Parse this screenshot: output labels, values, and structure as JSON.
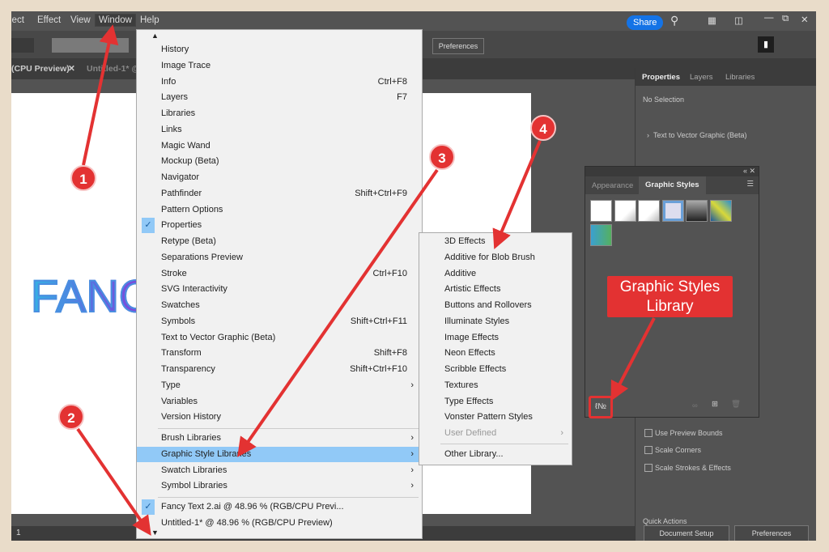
{
  "menubar": {
    "items": [
      "lect",
      "Effect",
      "View",
      "Window",
      "Help"
    ],
    "share": "Share"
  },
  "control": {
    "preferences": "Preferences"
  },
  "doc_tabs": [
    "(CPU Preview)",
    "Untitled-1* @"
  ],
  "artboard_text": "FANC",
  "status": {
    "zoom": "1"
  },
  "window_menu": {
    "items": [
      {
        "label": "History"
      },
      {
        "label": "Image Trace"
      },
      {
        "label": "Info",
        "shortcut": "Ctrl+F8"
      },
      {
        "label": "Layers",
        "shortcut": "F7"
      },
      {
        "label": "Libraries"
      },
      {
        "label": "Links"
      },
      {
        "label": "Magic Wand"
      },
      {
        "label": "Mockup (Beta)"
      },
      {
        "label": "Navigator"
      },
      {
        "label": "Pathfinder",
        "shortcut": "Shift+Ctrl+F9"
      },
      {
        "label": "Pattern Options"
      },
      {
        "label": "Properties",
        "checked": true
      },
      {
        "label": "Retype (Beta)"
      },
      {
        "label": "Separations Preview"
      },
      {
        "label": "Stroke",
        "shortcut": "Ctrl+F10"
      },
      {
        "label": "SVG Interactivity"
      },
      {
        "label": "Swatches"
      },
      {
        "label": "Symbols",
        "shortcut": "Shift+Ctrl+F11"
      },
      {
        "label": "Text to Vector Graphic (Beta)"
      },
      {
        "label": "Transform",
        "shortcut": "Shift+F8"
      },
      {
        "label": "Transparency",
        "shortcut": "Shift+Ctrl+F10"
      },
      {
        "label": "Type",
        "submenu": true
      },
      {
        "label": "Variables"
      },
      {
        "label": "Version History"
      }
    ],
    "libraries": [
      {
        "label": "Brush Libraries",
        "submenu": true
      },
      {
        "label": "Graphic Style Libraries",
        "submenu": true,
        "highlighted": true
      },
      {
        "label": "Swatch Libraries",
        "submenu": true
      },
      {
        "label": "Symbol Libraries",
        "submenu": true
      }
    ],
    "documents": [
      {
        "label": "Fancy Text 2.ai @ 48.96 % (RGB/CPU Previ...",
        "checked": true
      },
      {
        "label": "Untitled-1* @ 48.96 % (RGB/CPU Preview)"
      }
    ]
  },
  "graphic_style_libraries": {
    "items": [
      "3D Effects",
      "Additive for Blob Brush",
      "Additive",
      "Artistic Effects",
      "Buttons and Rollovers",
      "Illuminate Styles",
      "Image Effects",
      "Neon Effects",
      "Scribble Effects",
      "Textures",
      "Type Effects",
      "Vonster Pattern Styles"
    ],
    "disabled": "User Defined",
    "other": "Other Library..."
  },
  "properties_panel": {
    "tabs": [
      "Properties",
      "Layers",
      "Libraries"
    ],
    "no_selection": "No Selection",
    "text_to_vector": "Text to Vector Graphic (Beta)",
    "checkboxes": [
      "Use Preview Bounds",
      "Scale Corners",
      "Scale Strokes & Effects"
    ],
    "quick_actions": "Quick Actions",
    "document_setup": "Document Setup",
    "preferences": "Preferences"
  },
  "graphic_styles_panel": {
    "tabs": [
      "Appearance",
      "Graphic Styles"
    ],
    "swatch_count": 7
  },
  "annotations": {
    "callout": "Graphic Styles Library",
    "badges": [
      "1",
      "2",
      "3",
      "4"
    ],
    "color": "#e33232"
  }
}
